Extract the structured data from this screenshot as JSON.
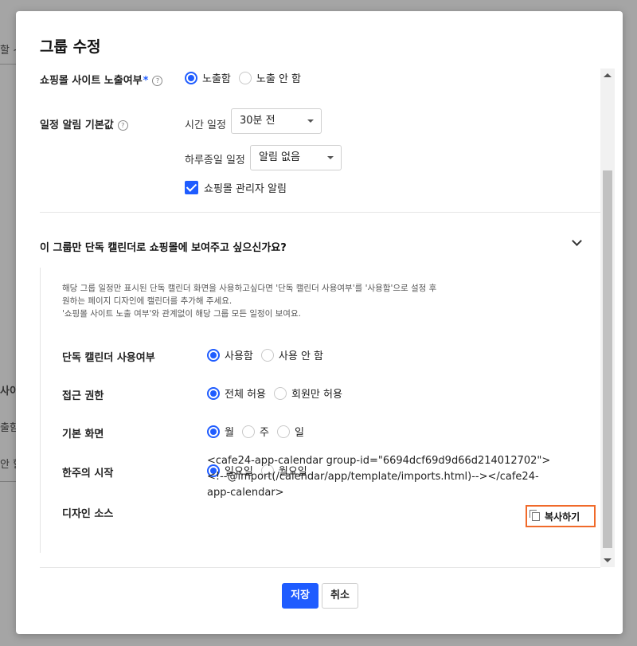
{
  "background": {
    "frag1": "할 ~",
    "frag2": "사이트",
    "frag3": "출함",
    "frag4": "안 할"
  },
  "modal": {
    "title": "그룹 수정",
    "exposure": {
      "label": "쇼핑몰 사이트 노출여부",
      "required_mark": "*",
      "options": [
        "노출함",
        "노출 안 함"
      ],
      "selected": 0
    },
    "reminder": {
      "label": "일정 알림 기본값",
      "time_label": "시간 일정",
      "time_value": "30분 전",
      "allday_label": "하루종일 일정",
      "allday_value": "알림 없음",
      "admin_alert_label": "쇼핑몰 관리자 알림",
      "admin_alert_checked": true
    },
    "section": {
      "question": "이 그룹만 단독 캘린더로 쇼핑몰에 보여주고 싶으신가요?",
      "info_lines": [
        "해당 그룹 일정만 표시된 단독 캘린더 화면을 사용하고싶다면 '단독 캘린더 사용여부'를 '사용함'으로 설정 후",
        "원하는 페이지 디자인에 캘린더를 추가해 주세요.",
        "'쇼핑몰 사이트 노출 여부'와 관계없이 해당 그룹 모든 일정이 보여요."
      ],
      "standalone": {
        "label": "단독 캘린더 사용여부",
        "options": [
          "사용함",
          "사용 안 함"
        ],
        "selected": 0
      },
      "access": {
        "label": "접근 권한",
        "options": [
          "전체 허용",
          "회원만 허용"
        ],
        "selected": 0
      },
      "default_view": {
        "label": "기본 화면",
        "options": [
          "월",
          "주",
          "일"
        ],
        "selected": 0
      },
      "week_start": {
        "label": "한주의 시작",
        "options": [
          "일요일",
          "월요일"
        ],
        "selected": 0
      },
      "design_source": {
        "label": "디자인 소스",
        "lines": [
          "<cafe24-app-calendar group-id=\"6694dcf69d9d66d214012702\">",
          "<!--@import(/calendar/app/template/imports.html)--></cafe24-",
          "app-calendar>"
        ],
        "copy_label": "복사하기"
      }
    },
    "footer": {
      "save_label": "저장",
      "cancel_label": "취소"
    }
  }
}
